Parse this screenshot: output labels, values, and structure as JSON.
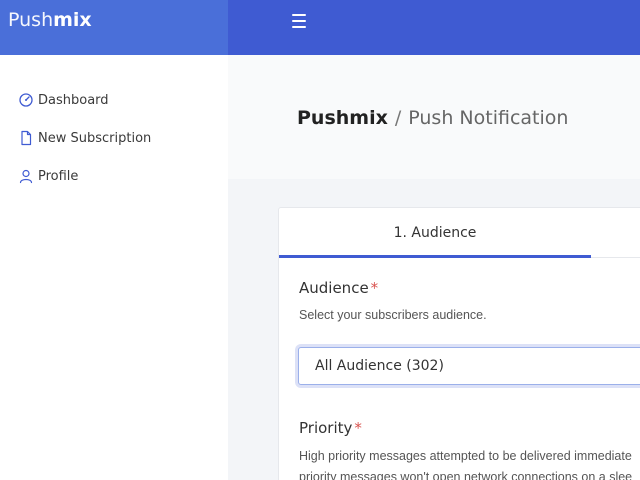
{
  "brand": {
    "part1": "Push",
    "part2": "mix"
  },
  "sidebar": {
    "items": [
      {
        "label": "Dashboard",
        "icon": "speedometer-icon"
      },
      {
        "label": "New Subscription",
        "icon": "document-icon"
      },
      {
        "label": "Profile",
        "icon": "user-icon"
      }
    ]
  },
  "breadcrumb": {
    "root": "Pushmix",
    "separator": "/",
    "current": "Push Notification"
  },
  "tabs": [
    {
      "label": "1. Audience",
      "active": true
    }
  ],
  "audience": {
    "label": "Audience",
    "required_mark": "*",
    "help": "Select your subscribers audience.",
    "selected": "All Audience (302)"
  },
  "priority": {
    "label": "Priority",
    "required_mark": "*",
    "description_line1": "High priority messages attempted to be delivered immediate",
    "description_line2": "priority messages won't open network connections on a slee"
  },
  "colors": {
    "brand_bg": "#4a6fd9",
    "topbar_bg": "#3f5bd2",
    "accent": "#3f5bd2",
    "required": "#d9534f",
    "icon": "#3f5bd2"
  }
}
